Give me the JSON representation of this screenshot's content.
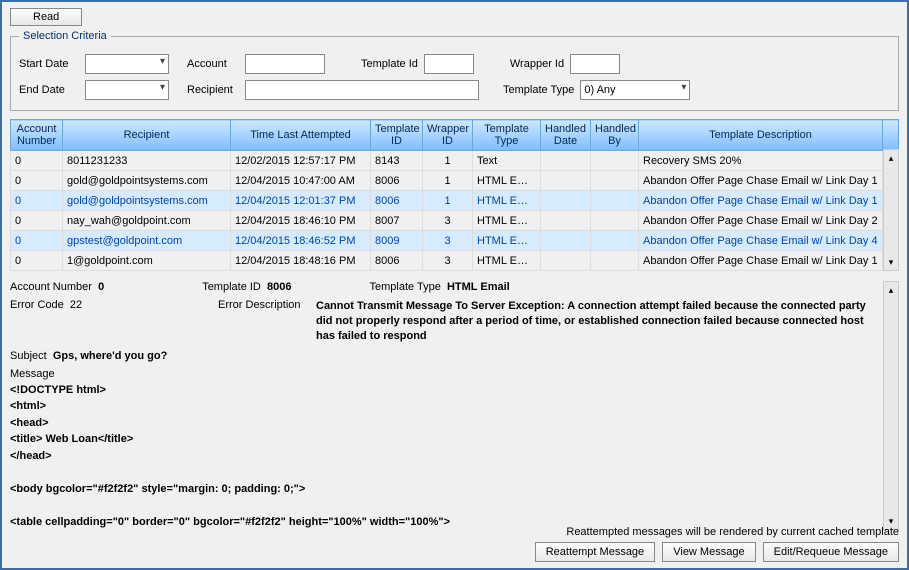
{
  "toolbar": {
    "read_label": "Read"
  },
  "criteria": {
    "legend": "Selection Criteria",
    "start_date_label": "Start Date",
    "start_date_value": "",
    "end_date_label": "End Date",
    "end_date_value": "",
    "account_label": "Account",
    "account_value": "",
    "recipient_label": "Recipient",
    "recipient_value": "",
    "template_id_label": "Template Id",
    "template_id_value": "",
    "wrapper_id_label": "Wrapper Id",
    "wrapper_id_value": "",
    "template_type_label": "Template Type",
    "template_type_value": "0) Any"
  },
  "grid": {
    "headers": {
      "account_number": "Account Number",
      "recipient": "Recipient",
      "time_last_attempted": "Time Last Attempted",
      "template_id": "Template ID",
      "wrapper_id": "Wrapper ID",
      "template_type": "Template Type",
      "handled_date": "Handled Date",
      "handled_by": "Handled By",
      "template_description": "Template Description"
    },
    "rows": [
      {
        "account_number": "0",
        "recipient": "8011231233",
        "time_last_attempted": "12/02/2015 12:57:17 PM",
        "template_id": "8143",
        "wrapper_id": "1",
        "template_type": "Text",
        "handled_date": "",
        "handled_by": "",
        "template_description": "Recovery SMS 20%",
        "selected": false
      },
      {
        "account_number": "0",
        "recipient": "gold@goldpointsystems.com",
        "time_last_attempted": "12/04/2015 10:47:00 AM",
        "template_id": "8006",
        "wrapper_id": "1",
        "template_type": "HTML Email",
        "handled_date": "",
        "handled_by": "",
        "template_description": "Abandon Offer Page Chase Email w/ Link Day 1",
        "selected": false
      },
      {
        "account_number": "0",
        "recipient": "gold@goldpointsystems.com",
        "time_last_attempted": "12/04/2015 12:01:37 PM",
        "template_id": "8006",
        "wrapper_id": "1",
        "template_type": "HTML Email",
        "handled_date": "",
        "handled_by": "",
        "template_description": "Abandon Offer Page Chase Email w/ Link Day 1",
        "selected": true
      },
      {
        "account_number": "0",
        "recipient": "nay_wah@goldpoint.com",
        "time_last_attempted": "12/04/2015 18:46:10 PM",
        "template_id": "8007",
        "wrapper_id": "3",
        "template_type": "HTML Email",
        "handled_date": "",
        "handled_by": "",
        "template_description": "Abandon Offer Page Chase Email w/ Link Day 2",
        "selected": false
      },
      {
        "account_number": "0",
        "recipient": "gpstest@goldpoint.com",
        "time_last_attempted": "12/04/2015 18:46:52 PM",
        "template_id": "8009",
        "wrapper_id": "3",
        "template_type": "HTML Email",
        "handled_date": "",
        "handled_by": "",
        "template_description": "Abandon Offer Page Chase Email w/ Link Day 4",
        "selected": true
      },
      {
        "account_number": "0",
        "recipient": "1@goldpoint.com",
        "time_last_attempted": "12/04/2015 18:48:16 PM",
        "template_id": "8006",
        "wrapper_id": "3",
        "template_type": "HTML Email",
        "handled_date": "",
        "handled_by": "",
        "template_description": "Abandon Offer Page Chase Email w/ Link Day 1",
        "selected": false
      }
    ]
  },
  "detail": {
    "account_number_label": "Account Number",
    "account_number_value": "0",
    "template_id_label": "Template ID",
    "template_id_value": "8006",
    "template_type_label": "Template Type",
    "template_type_value": "HTML Email",
    "error_code_label": "Error Code",
    "error_code_value": "22",
    "error_description_label": "Error Description",
    "error_description_value": "Cannot Transmit Message To Server Exception: A connection attempt failed because the connected party did not properly respond after a period of time, or established connection failed because connected host has failed to respond",
    "subject_label": "Subject",
    "subject_value": "Gps, where'd you go?",
    "message_label": "Message",
    "message_body": "<!DOCTYPE html>\n<html>\n<head>\n<title> Web Loan</title>\n</head>\n\n<body bgcolor=\"#f2f2f2\" style=\"margin: 0; padding: 0;\">\n\n<table cellpadding=\"0\" border=\"0\" bgcolor=\"#f2f2f2\" height=\"100%\" width=\"100%\">"
  },
  "footer": {
    "note": "Reattempted messages will be rendered by current cached template",
    "reattempt_label": "Reattempt Message",
    "view_label": "View Message",
    "edit_label": "Edit/Requeue Message"
  }
}
